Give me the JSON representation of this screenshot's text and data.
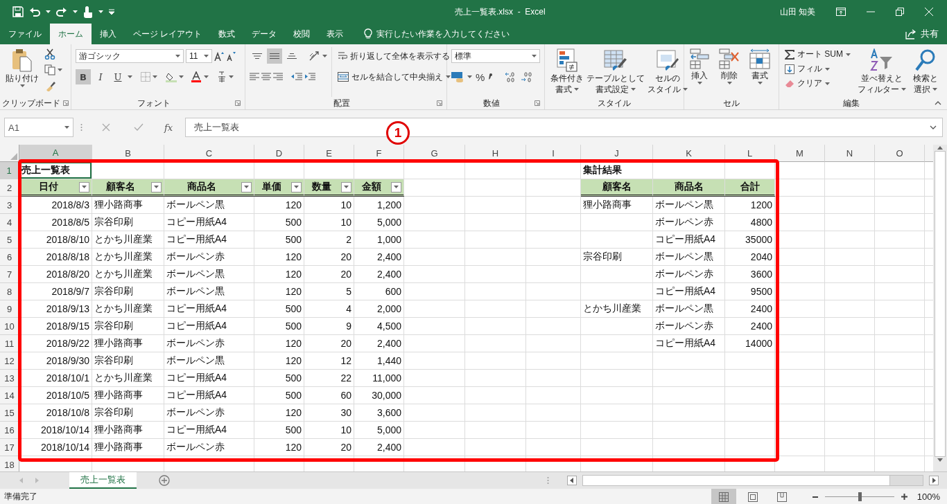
{
  "window": {
    "title": "売上一覧表.xlsx  -  Excel",
    "user": "山田 知美"
  },
  "ribbon_tabs": [
    {
      "label": "ファイル",
      "selected": false
    },
    {
      "label": "ホーム",
      "selected": true
    },
    {
      "label": "挿入",
      "selected": false
    },
    {
      "label": "ページ レイアウト",
      "selected": false
    },
    {
      "label": "数式",
      "selected": false
    },
    {
      "label": "データ",
      "selected": false
    },
    {
      "label": "校閲",
      "selected": false
    },
    {
      "label": "表示",
      "selected": false
    }
  ],
  "tell_me": {
    "placeholder": "実行したい作業を入力してください"
  },
  "share": "共有",
  "ribbon_groups": [
    {
      "kind": "clipboard",
      "label": "クリップボード",
      "paste": "貼り付け"
    },
    {
      "kind": "font",
      "label": "フォント",
      "font_name": "游ゴシック",
      "font_size": "11",
      "styles": [
        {
          "label": "B",
          "pressed": true
        },
        {
          "label": "I",
          "pressed": false
        },
        {
          "label": "U",
          "pressed": false
        }
      ]
    },
    {
      "kind": "alignment",
      "label": "配置",
      "vertical": [
        {
          "pressed": false
        },
        {
          "pressed": true
        },
        {
          "pressed": false
        }
      ],
      "wrap": "折り返して全体を表示する",
      "merge": "セルを結合して中央揃え"
    },
    {
      "kind": "number",
      "label": "数値",
      "format": "標準",
      "percent": "%"
    },
    {
      "kind": "styles",
      "label": "スタイル",
      "buttons": [
        {
          "lines": [
            "条件付き",
            "書式"
          ]
        },
        {
          "lines": [
            "テーブルとして",
            "書式設定"
          ]
        },
        {
          "lines": [
            "セルの",
            "スタイル"
          ]
        }
      ]
    },
    {
      "kind": "cells",
      "label": "セル",
      "buttons": [
        "挿入",
        "削除",
        "書式"
      ]
    },
    {
      "kind": "editing",
      "label": "編集",
      "items": [
        "オート SUM",
        "フィル",
        "クリア"
      ],
      "buttons": [
        {
          "lines": [
            "並べ替えと",
            "フィルター"
          ]
        },
        {
          "lines": [
            "検索と",
            "選択"
          ]
        }
      ]
    }
  ],
  "formula_bar": {
    "name_box": "A1",
    "fx": "fx",
    "formula": "売上一覧表"
  },
  "callout": {
    "label": "1"
  },
  "sheet": {
    "columns": [
      {
        "label": "A",
        "selected": true
      },
      {
        "label": "B",
        "selected": false
      },
      {
        "label": "C",
        "selected": false
      },
      {
        "label": "D",
        "selected": false
      },
      {
        "label": "E",
        "selected": false
      },
      {
        "label": "F",
        "selected": false
      },
      {
        "label": "G",
        "selected": false
      },
      {
        "label": "H",
        "selected": false
      },
      {
        "label": "I",
        "selected": false
      },
      {
        "label": "J",
        "selected": false
      },
      {
        "label": "K",
        "selected": false
      },
      {
        "label": "L",
        "selected": false
      },
      {
        "label": "M",
        "selected": false
      },
      {
        "label": "N",
        "selected": false
      },
      {
        "label": "O",
        "selected": false
      }
    ],
    "rows": [
      {
        "label": "1",
        "selected": true
      },
      {
        "label": "2",
        "selected": false
      },
      {
        "label": "3",
        "selected": false
      },
      {
        "label": "4",
        "selected": false
      },
      {
        "label": "5",
        "selected": false
      },
      {
        "label": "6",
        "selected": false
      },
      {
        "label": "7",
        "selected": false
      },
      {
        "label": "8",
        "selected": false
      },
      {
        "label": "9",
        "selected": false
      },
      {
        "label": "10",
        "selected": false
      },
      {
        "label": "11",
        "selected": false
      },
      {
        "label": "12",
        "selected": false
      },
      {
        "label": "13",
        "selected": false
      },
      {
        "label": "14",
        "selected": false
      },
      {
        "label": "15",
        "selected": false
      },
      {
        "label": "16",
        "selected": false
      },
      {
        "label": "17",
        "selected": false
      },
      {
        "label": "18",
        "selected": false
      }
    ],
    "title": "売上一覧表",
    "summary_title": "集計結果",
    "sales_table": {
      "columns": [
        {
          "label": "日付",
          "filter": true
        },
        {
          "label": "顧客名",
          "filter": true
        },
        {
          "label": "商品名",
          "filter": true
        },
        {
          "label": "単価",
          "filter": true
        },
        {
          "label": "数量",
          "filter": true
        },
        {
          "label": "金額",
          "filter": true
        }
      ],
      "rows": [
        [
          "2018/8/3",
          "狸小路商事",
          "ボールペン黒",
          "120",
          "10",
          "1,200"
        ],
        [
          "2018/8/5",
          "宗谷印刷",
          "コピー用紙A4",
          "500",
          "10",
          "5,000"
        ],
        [
          "2018/8/10",
          "とかち川産業",
          "コピー用紙A4",
          "500",
          "2",
          "1,000"
        ],
        [
          "2018/8/18",
          "とかち川産業",
          "ボールペン赤",
          "120",
          "20",
          "2,400"
        ],
        [
          "2018/8/20",
          "とかち川産業",
          "ボールペン黒",
          "120",
          "20",
          "2,400"
        ],
        [
          "2018/9/7",
          "宗谷印刷",
          "ボールペン黒",
          "120",
          "5",
          "600"
        ],
        [
          "2018/9/13",
          "とかち川産業",
          "コピー用紙A4",
          "500",
          "4",
          "2,000"
        ],
        [
          "2018/9/15",
          "宗谷印刷",
          "コピー用紙A4",
          "500",
          "9",
          "4,500"
        ],
        [
          "2018/9/22",
          "狸小路商事",
          "ボールペン赤",
          "120",
          "20",
          "2,400"
        ],
        [
          "2018/9/30",
          "宗谷印刷",
          "ボールペン黒",
          "120",
          "12",
          "1,440"
        ],
        [
          "2018/10/1",
          "とかち川産業",
          "コピー用紙A4",
          "500",
          "22",
          "11,000"
        ],
        [
          "2018/10/5",
          "狸小路商事",
          "コピー用紙A4",
          "500",
          "60",
          "30,000"
        ],
        [
          "2018/10/8",
          "宗谷印刷",
          "ボールペン赤",
          "120",
          "30",
          "3,600"
        ],
        [
          "2018/10/14",
          "狸小路商事",
          "コピー用紙A4",
          "500",
          "10",
          "5,000"
        ],
        [
          "2018/10/14",
          "狸小路商事",
          "ボールペン赤",
          "120",
          "20",
          "2,400"
        ]
      ]
    },
    "summary_table": {
      "columns": [
        {
          "label": "顧客名"
        },
        {
          "label": "商品名"
        },
        {
          "label": "合計"
        }
      ],
      "rows": [
        {
          "customer": "狸小路商事",
          "product": "ボールペン黒",
          "total": "1200"
        },
        {
          "product": "ボールペン赤",
          "total": "4800"
        },
        {
          "product": "コピー用紙A4",
          "total": "35000"
        },
        {
          "customer": "宗谷印刷",
          "product": "ボールペン黒",
          "total": "2040"
        },
        {
          "product": "ボールペン赤",
          "total": "3600"
        },
        {
          "product": "コピー用紙A4",
          "total": "9500"
        },
        {
          "customer": "とかち川産業",
          "product": "ボールペン黒",
          "total": "2400"
        },
        {
          "product": "ボールペン赤",
          "total": "2400"
        },
        {
          "product": "コピー用紙A4",
          "total": "14000"
        }
      ]
    }
  },
  "sheet_tabs": [
    {
      "label": "売上一覧表",
      "selected": true
    }
  ],
  "status_bar": {
    "text": "準備完了",
    "views": [
      {
        "selected": true
      },
      {
        "selected": false
      },
      {
        "selected": false
      }
    ],
    "zoom": {
      "level": 0.5,
      "reading": "100%"
    }
  }
}
